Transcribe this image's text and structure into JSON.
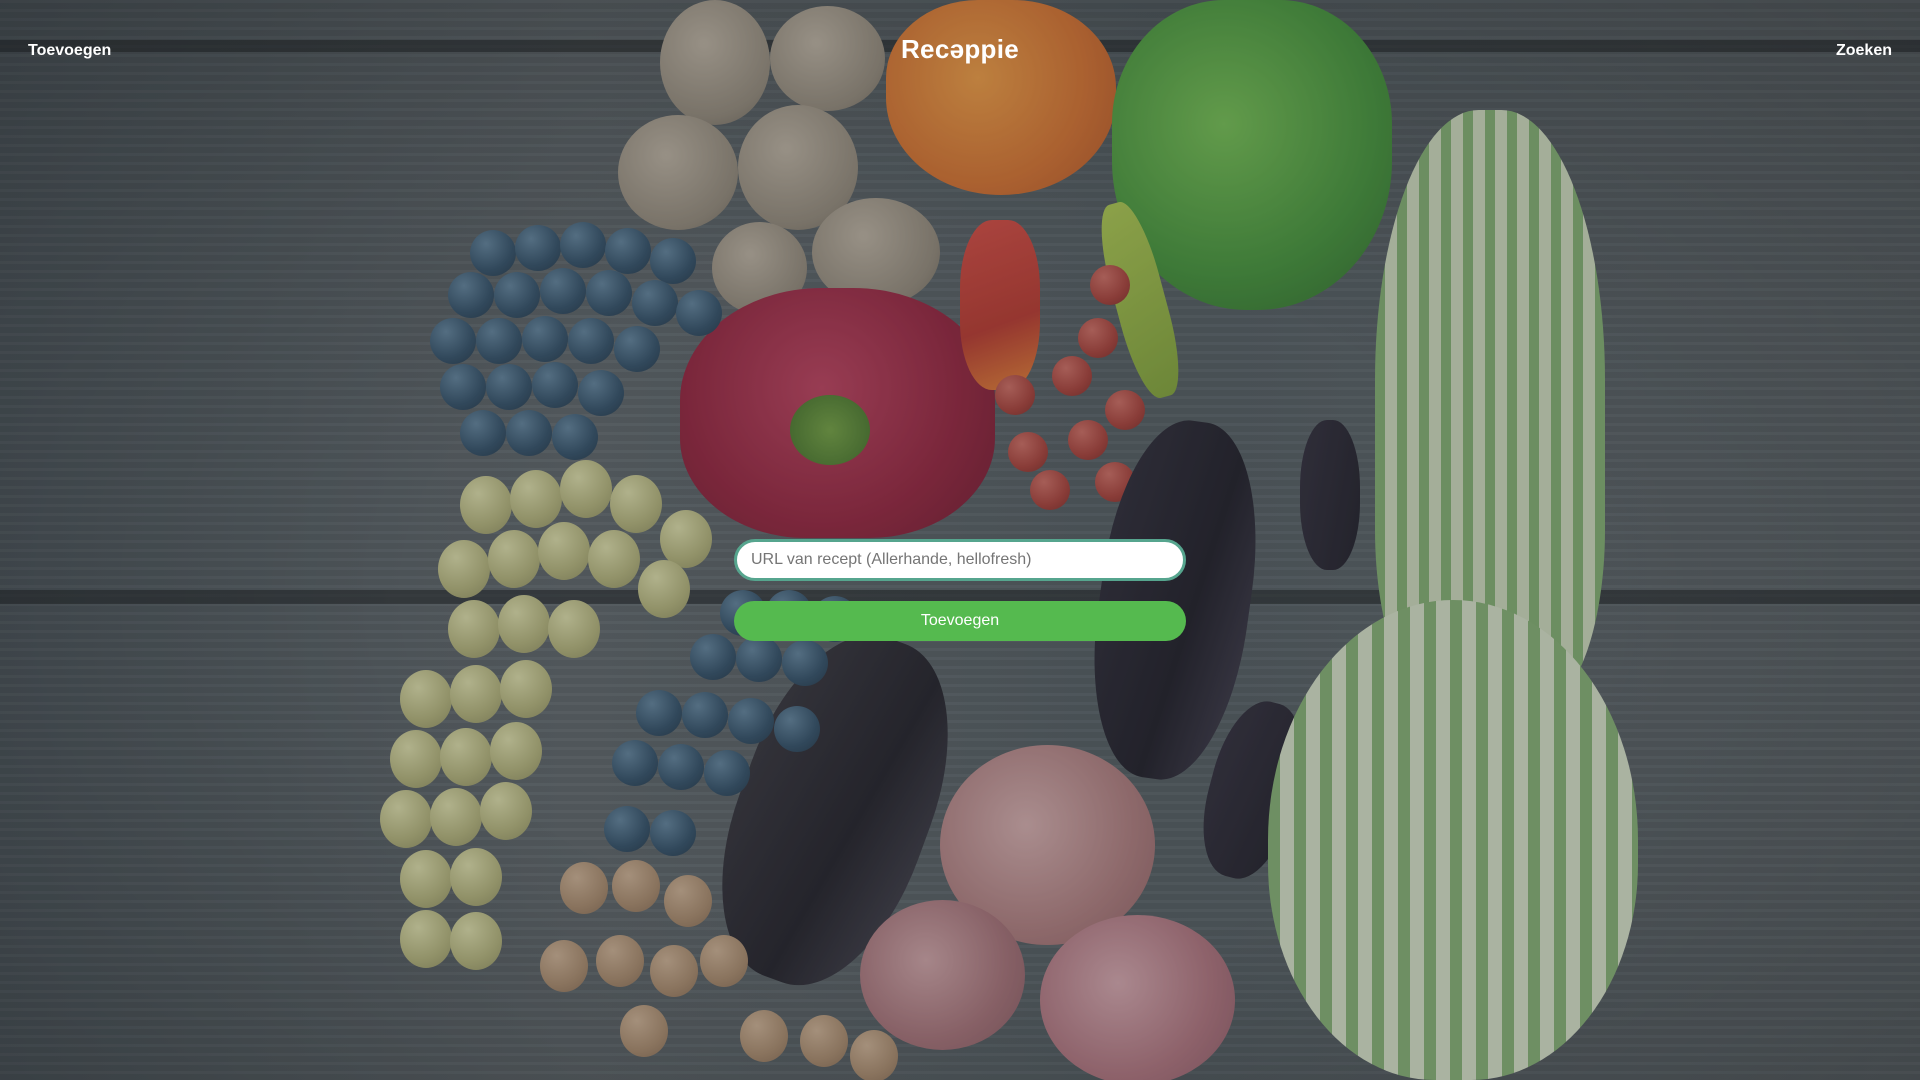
{
  "header": {
    "left_link": "Toevoegen",
    "brand": "Recəppie",
    "right_link": "Zoeken"
  },
  "form": {
    "url_placeholder": "URL van recept (Allerhande, hellofresh)",
    "url_value": "",
    "submit_label": "Toevoegen"
  },
  "colors": {
    "accent_button": "#55ba4f",
    "input_border": "#56a58e",
    "header_text": "#ffffff"
  },
  "background": {
    "image": "vegetables-on-wooden-table"
  }
}
